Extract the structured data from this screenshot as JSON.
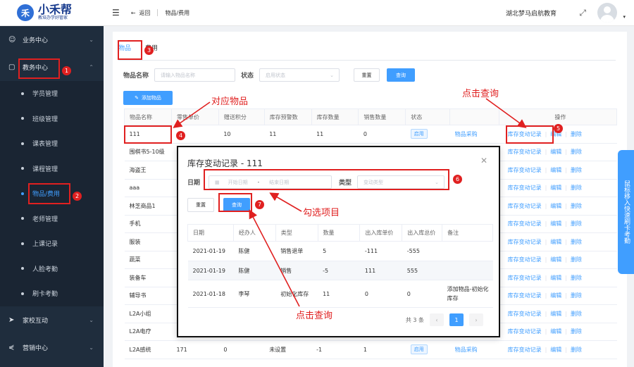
{
  "brand": {
    "name": "小禾帮",
    "slogan": "教培办学好管家",
    "logo_glyph": "禾"
  },
  "sidebar": {
    "groups": [
      {
        "label": "业务中心",
        "icon": "person-icon"
      },
      {
        "label": "教务中心",
        "icon": "book-icon"
      },
      {
        "label": "家校互动",
        "icon": "send-icon"
      },
      {
        "label": "营销中心",
        "icon": "share-icon"
      }
    ],
    "sub_items": [
      "学员管理",
      "班级管理",
      "课表管理",
      "课程管理",
      "物品/费用",
      "老师管理",
      "上课记录",
      "人脸考勤",
      "刷卡考勤"
    ],
    "active": "物品/费用"
  },
  "header": {
    "back": "返回",
    "breadcrumb": "物品/费用",
    "org": "湖北梦马启航教育"
  },
  "tabs": [
    "物品",
    "费用"
  ],
  "filter": {
    "name_label": "物品名称",
    "name_placeholder": "请输入物品名称",
    "status_label": "状态",
    "status_placeholder": "启用状态",
    "reset": "重置",
    "query": "查询"
  },
  "add_button": "添加物品",
  "table": {
    "headers": [
      "物品名称",
      "零售单价",
      "赠送积分",
      "库存预警数",
      "库存数量",
      "销售数量",
      "状态",
      "",
      "操作"
    ],
    "rows": [
      [
        "111",
        "",
        "10",
        "11",
        "11",
        "0",
        "启用",
        "物品采购",
        "库存变动记录",
        "编辑",
        "删除"
      ],
      [
        "围棋书5-10级",
        "",
        "",
        "",
        "",
        "",
        "",
        "",
        "库存变动记录",
        "编辑",
        "删除"
      ],
      [
        "海盗王",
        "",
        "",
        "",
        "",
        "",
        "",
        "",
        "库存变动记录",
        "编辑",
        "删除"
      ],
      [
        "aaa",
        "",
        "",
        "",
        "",
        "",
        "",
        "",
        "库存变动记录",
        "编辑",
        "删除"
      ],
      [
        "林芝商品1",
        "",
        "",
        "",
        "",
        "",
        "",
        "",
        "库存变动记录",
        "编辑",
        "删除"
      ],
      [
        "手机",
        "",
        "",
        "",
        "",
        "",
        "",
        "",
        "库存变动记录",
        "编辑",
        "删除"
      ],
      [
        "服装",
        "",
        "",
        "",
        "",
        "",
        "",
        "",
        "库存变动记录",
        "编辑",
        "删除"
      ],
      [
        "蔬菜",
        "",
        "",
        "",
        "",
        "",
        "",
        "",
        "库存变动记录",
        "编辑",
        "删除"
      ],
      [
        "装备车",
        "",
        "",
        "",
        "",
        "",
        "",
        "",
        "库存变动记录",
        "编辑",
        "删除"
      ],
      [
        "辅导书",
        "",
        "",
        "",
        "",
        "",
        "",
        "",
        "库存变动记录",
        "编辑",
        "删除"
      ],
      [
        "L2A小组",
        "",
        "",
        "",
        "",
        "",
        "",
        "",
        "库存变动记录",
        "编辑",
        "删除"
      ],
      [
        "L2A电疗",
        "",
        "",
        "",
        "",
        "",
        "",
        "",
        "库存变动记录",
        "编辑",
        "删除"
      ],
      [
        "L2A感统",
        "171",
        "0",
        "未设置",
        "-1",
        "1",
        "启用",
        "物品采购",
        "库存变动记录",
        "编辑",
        "删除"
      ]
    ]
  },
  "modal": {
    "title": "库存变动记录 - 111",
    "date_label": "日期",
    "start_placeholder": "开始日期",
    "dash": "-",
    "end_placeholder": "结束日期",
    "type_label": "类型",
    "type_placeholder": "变动类型",
    "reset": "重置",
    "query": "查询",
    "headers": [
      "日期",
      "经办人",
      "类型",
      "数量",
      "出入库单价",
      "出入库总价",
      "备注"
    ],
    "rows": [
      [
        "2021-01-19",
        "陈健",
        "销售退单",
        "5",
        "-111",
        "-555",
        ""
      ],
      [
        "2021-01-19",
        "陈健",
        "销售",
        "-5",
        "111",
        "555",
        ""
      ],
      [
        "2021-01-18",
        "李琴",
        "初始化库存",
        "11",
        "0",
        "0",
        "添加物品-初始化库存"
      ]
    ],
    "total": "共 3 条",
    "page": "1"
  },
  "annotations": {
    "items": [
      "1",
      "2",
      "3",
      "4",
      "5",
      "6",
      "7"
    ],
    "notes": {
      "item": "对应物品",
      "click_query_top": "点击查询",
      "select": "勾选项目",
      "click_query_bottom": "点击查询"
    }
  },
  "float_panel": "鼠标移入快速刷卡考勤"
}
